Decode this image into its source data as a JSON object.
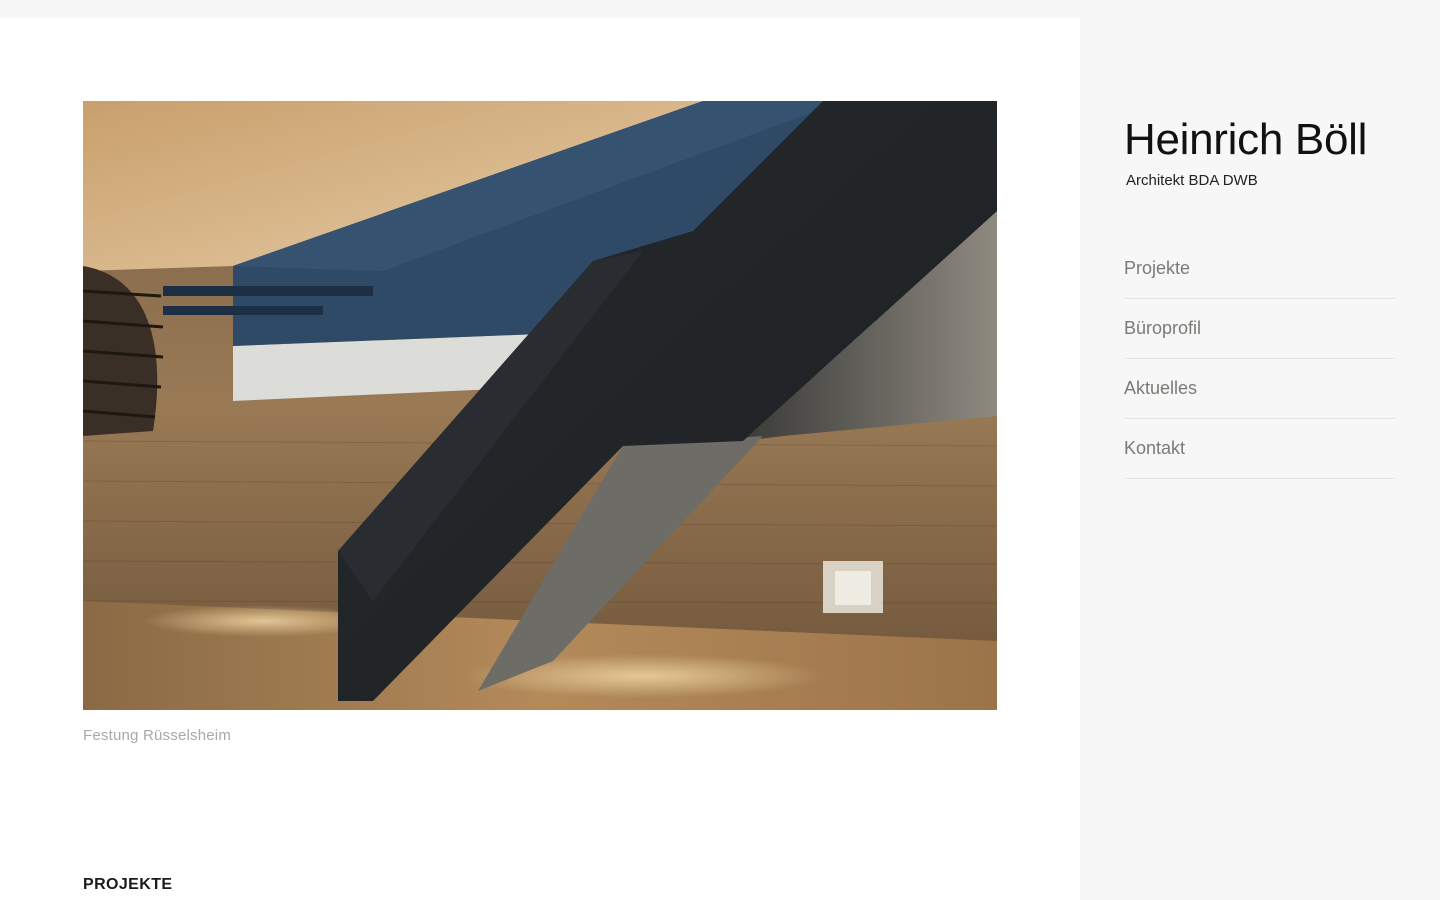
{
  "hero": {
    "caption": "Festung Rüsselsheim"
  },
  "section": {
    "heading": "PROJEKTE"
  },
  "brand": {
    "name": "Heinrich Böll",
    "subtitle": "Architekt BDA DWB"
  },
  "nav": {
    "items": [
      {
        "label": "Projekte"
      },
      {
        "label": "Büroprofil"
      },
      {
        "label": "Aktuelles"
      },
      {
        "label": "Kontakt"
      }
    ]
  },
  "colors": {
    "page_background": "#f7f7f7",
    "content_background": "#ffffff",
    "nav_text": "#7c7a75",
    "caption_text": "#a8a8a8"
  }
}
